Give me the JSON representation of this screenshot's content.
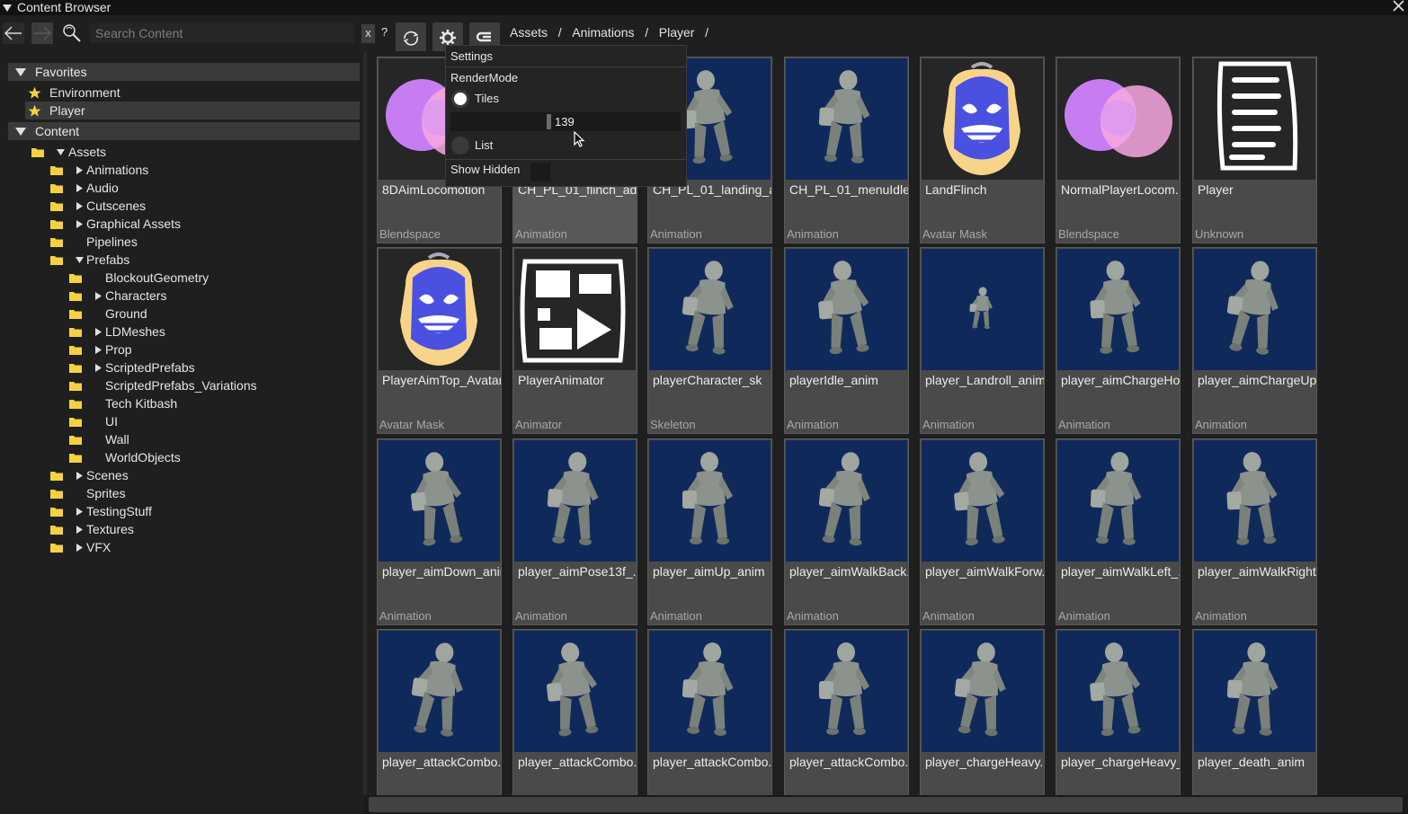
{
  "window": {
    "title": "Content Browser"
  },
  "toolbar": {
    "search_placeholder": "Search Content",
    "clear_label": "x",
    "help_label": "?",
    "breadcrumbs": [
      "Assets",
      "Animations",
      "Player"
    ],
    "separator": "/"
  },
  "sidebar": {
    "favorites_header": "Favorites",
    "favorites": [
      {
        "label": "Environment"
      },
      {
        "label": "Player",
        "selected": true
      }
    ],
    "content_header": "Content",
    "tree": [
      {
        "label": "Assets",
        "depth": 0,
        "arrow": "down"
      },
      {
        "label": "Animations",
        "depth": 1,
        "arrow": "right"
      },
      {
        "label": "Audio",
        "depth": 1,
        "arrow": "right"
      },
      {
        "label": "Cutscenes",
        "depth": 1,
        "arrow": "right"
      },
      {
        "label": "Graphical Assets",
        "depth": 1,
        "arrow": "right"
      },
      {
        "label": "Pipelines",
        "depth": 1,
        "arrow": "none"
      },
      {
        "label": "Prefabs",
        "depth": 1,
        "arrow": "down"
      },
      {
        "label": "BlockoutGeometry",
        "depth": 2,
        "arrow": "none"
      },
      {
        "label": "Characters",
        "depth": 2,
        "arrow": "right"
      },
      {
        "label": "Ground",
        "depth": 2,
        "arrow": "none"
      },
      {
        "label": "LDMeshes",
        "depth": 2,
        "arrow": "right"
      },
      {
        "label": "Prop",
        "depth": 2,
        "arrow": "right"
      },
      {
        "label": "ScriptedPrefabs",
        "depth": 2,
        "arrow": "right"
      },
      {
        "label": "ScriptedPrefabs_Variations",
        "depth": 2,
        "arrow": "none"
      },
      {
        "label": "Tech Kitbash",
        "depth": 2,
        "arrow": "none"
      },
      {
        "label": "UI",
        "depth": 2,
        "arrow": "none"
      },
      {
        "label": "Wall",
        "depth": 2,
        "arrow": "none"
      },
      {
        "label": "WorldObjects",
        "depth": 2,
        "arrow": "none"
      },
      {
        "label": "Scenes",
        "depth": 1,
        "arrow": "right"
      },
      {
        "label": "Sprites",
        "depth": 1,
        "arrow": "none"
      },
      {
        "label": "TestingStuff",
        "depth": 1,
        "arrow": "right"
      },
      {
        "label": "Textures",
        "depth": 1,
        "arrow": "right"
      },
      {
        "label": "VFX",
        "depth": 1,
        "arrow": "right"
      }
    ]
  },
  "settings_popup": {
    "title": "Settings",
    "render_mode_label": "RenderMode",
    "tiles_label": "Tiles",
    "tile_size_value": "139",
    "list_label": "List",
    "show_hidden_label": "Show Hidden",
    "selected_mode": "Tiles"
  },
  "assets": [
    {
      "name": "8DAimLocomotion",
      "type": "Blendspace",
      "thumb": "blendspace-icon"
    },
    {
      "name": "CH_PL_01_flinch_ad...",
      "type": "Animation",
      "thumb": "character",
      "selected": true
    },
    {
      "name": "CH_PL_01_landing_a...",
      "type": "Animation",
      "thumb": "character"
    },
    {
      "name": "CH_PL_01_menuIdle...",
      "type": "Animation",
      "thumb": "character"
    },
    {
      "name": "LandFlinch",
      "type": "Avatar Mask",
      "thumb": "mask-icon"
    },
    {
      "name": "NormalPlayerLocom...",
      "type": "Blendspace",
      "thumb": "blendspace-icon"
    },
    {
      "name": "Player",
      "type": "Unknown",
      "thumb": "document-icon"
    },
    {
      "name": "PlayerAimTop_Avatar",
      "type": "Avatar Mask",
      "thumb": "mask-icon"
    },
    {
      "name": "PlayerAnimator",
      "type": "Animator",
      "thumb": "animator-icon"
    },
    {
      "name": "playerCharacter_sk",
      "type": "Skeleton",
      "thumb": "character"
    },
    {
      "name": "playerIdle_anim",
      "type": "Animation",
      "thumb": "character"
    },
    {
      "name": "player_Landroll_anim",
      "type": "Animation",
      "thumb": "character-small"
    },
    {
      "name": "player_aimChargeHo...",
      "type": "Animation",
      "thumb": "character"
    },
    {
      "name": "player_aimChargeUp...",
      "type": "Animation",
      "thumb": "character"
    },
    {
      "name": "player_aimDown_anim",
      "type": "Animation",
      "thumb": "character"
    },
    {
      "name": "player_aimPose13f_...",
      "type": "Animation",
      "thumb": "character"
    },
    {
      "name": "player_aimUp_anim",
      "type": "Animation",
      "thumb": "character"
    },
    {
      "name": "player_aimWalkBack...",
      "type": "Animation",
      "thumb": "character"
    },
    {
      "name": "player_aimWalkForw...",
      "type": "Animation",
      "thumb": "character"
    },
    {
      "name": "player_aimWalkLeft_...",
      "type": "Animation",
      "thumb": "character"
    },
    {
      "name": "player_aimWalkRight...",
      "type": "Animation",
      "thumb": "character"
    },
    {
      "name": "player_attackCombo...",
      "type": "",
      "thumb": "character"
    },
    {
      "name": "player_attackCombo...",
      "type": "",
      "thumb": "character"
    },
    {
      "name": "player_attackCombo...",
      "type": "",
      "thumb": "character"
    },
    {
      "name": "player_attackCombo...",
      "type": "",
      "thumb": "character"
    },
    {
      "name": "player_chargeHeavy...",
      "type": "",
      "thumb": "character"
    },
    {
      "name": "player_chargeHeavy_...",
      "type": "",
      "thumb": "character"
    },
    {
      "name": "player_death_anim",
      "type": "",
      "thumb": "character"
    }
  ],
  "colors": {
    "background": "#1f1f1f",
    "panel_header": "#3a3a3a",
    "tile_bg": "#4a4a4a",
    "thumb_blue": "#0f2a5a",
    "folder_yellow": "#f5d142",
    "star_yellow": "#f5d142"
  }
}
